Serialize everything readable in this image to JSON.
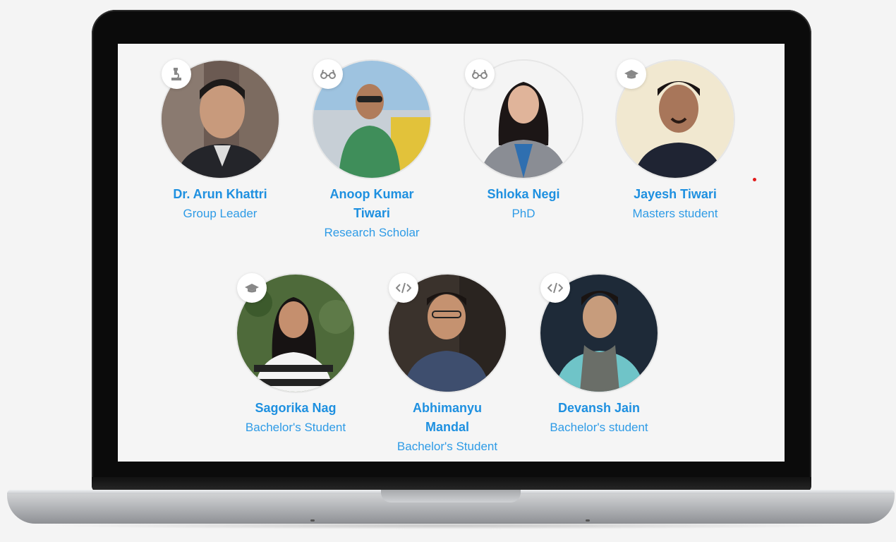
{
  "accent_color": "#1e90e0",
  "members": [
    {
      "name": "Dr. Arun Khattri",
      "role": "Group Leader",
      "icon": "microscope-icon"
    },
    {
      "name": "Anoop Kumar Tiwari",
      "role": "Research Scholar",
      "icon": "glasses-icon"
    },
    {
      "name": "Shloka Negi",
      "role": "PhD",
      "icon": "glasses-icon"
    },
    {
      "name": "Jayesh Tiwari",
      "role": "Masters student",
      "icon": "graduation-cap-icon"
    },
    {
      "name": "Sagorika Nag",
      "role": "Bachelor's Student",
      "icon": "graduation-cap-icon"
    },
    {
      "name": "Abhimanyu Mandal",
      "role": "Bachelor's Student",
      "icon": "code-icon"
    },
    {
      "name": "Devansh Jain",
      "role": "Bachelor's student",
      "icon": "code-icon"
    }
  ]
}
